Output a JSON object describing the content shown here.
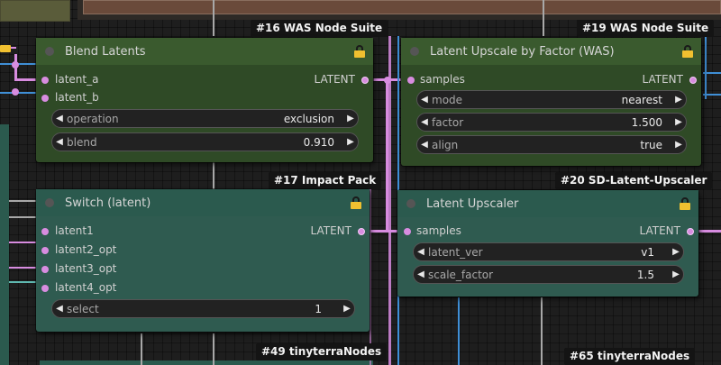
{
  "nodes": {
    "blend": {
      "title": "Blend Latents",
      "inputs": [
        "latent_a",
        "latent_b"
      ],
      "output": "LATENT",
      "widgets": [
        {
          "label": "operation",
          "value": "exclusion"
        },
        {
          "label": "blend",
          "value": "0.910"
        }
      ],
      "badge": "#16 WAS Node Suite"
    },
    "upscale_factor": {
      "title": "Latent Upscale by Factor (WAS)",
      "inputs": [
        "samples"
      ],
      "output": "LATENT",
      "widgets": [
        {
          "label": "mode",
          "value": "nearest"
        },
        {
          "label": "factor",
          "value": "1.500"
        },
        {
          "label": "align",
          "value": "true"
        }
      ],
      "badge": "#19 WAS Node Suite"
    },
    "switch": {
      "title": "Switch (latent)",
      "inputs": [
        "latent1",
        "latent2_opt",
        "latent3_opt",
        "latent4_opt"
      ],
      "output": "LATENT",
      "widgets": [
        {
          "label": "select",
          "value": "1"
        }
      ],
      "badge": "#17 Impact Pack"
    },
    "upscaler": {
      "title": "Latent Upscaler",
      "inputs": [
        "samples"
      ],
      "output": "LATENT",
      "widgets": [
        {
          "label": "latent_ver",
          "value": "v1"
        },
        {
          "label": "scale_factor",
          "value": "1.5"
        }
      ],
      "badge": "#20 SD-Latent-Upscaler"
    }
  },
  "bottom_badges": [
    "#49 tinyterraNodes",
    "#65 tinyterraNodes"
  ],
  "icons": {
    "lock": "lock-icon",
    "left_arrow": "◀",
    "right_arrow": "▶"
  },
  "colors": {
    "canvas": "#1e1e1e",
    "link_latent": "#d88ce0",
    "link_blue": "#3f8fd6",
    "was_node_header": "#3a5a2e",
    "was_node_body": "#2f4a26",
    "teal_node_header": "#2b5a4e",
    "teal_node_body": "#2f5b50",
    "lock": "#f0c030"
  }
}
